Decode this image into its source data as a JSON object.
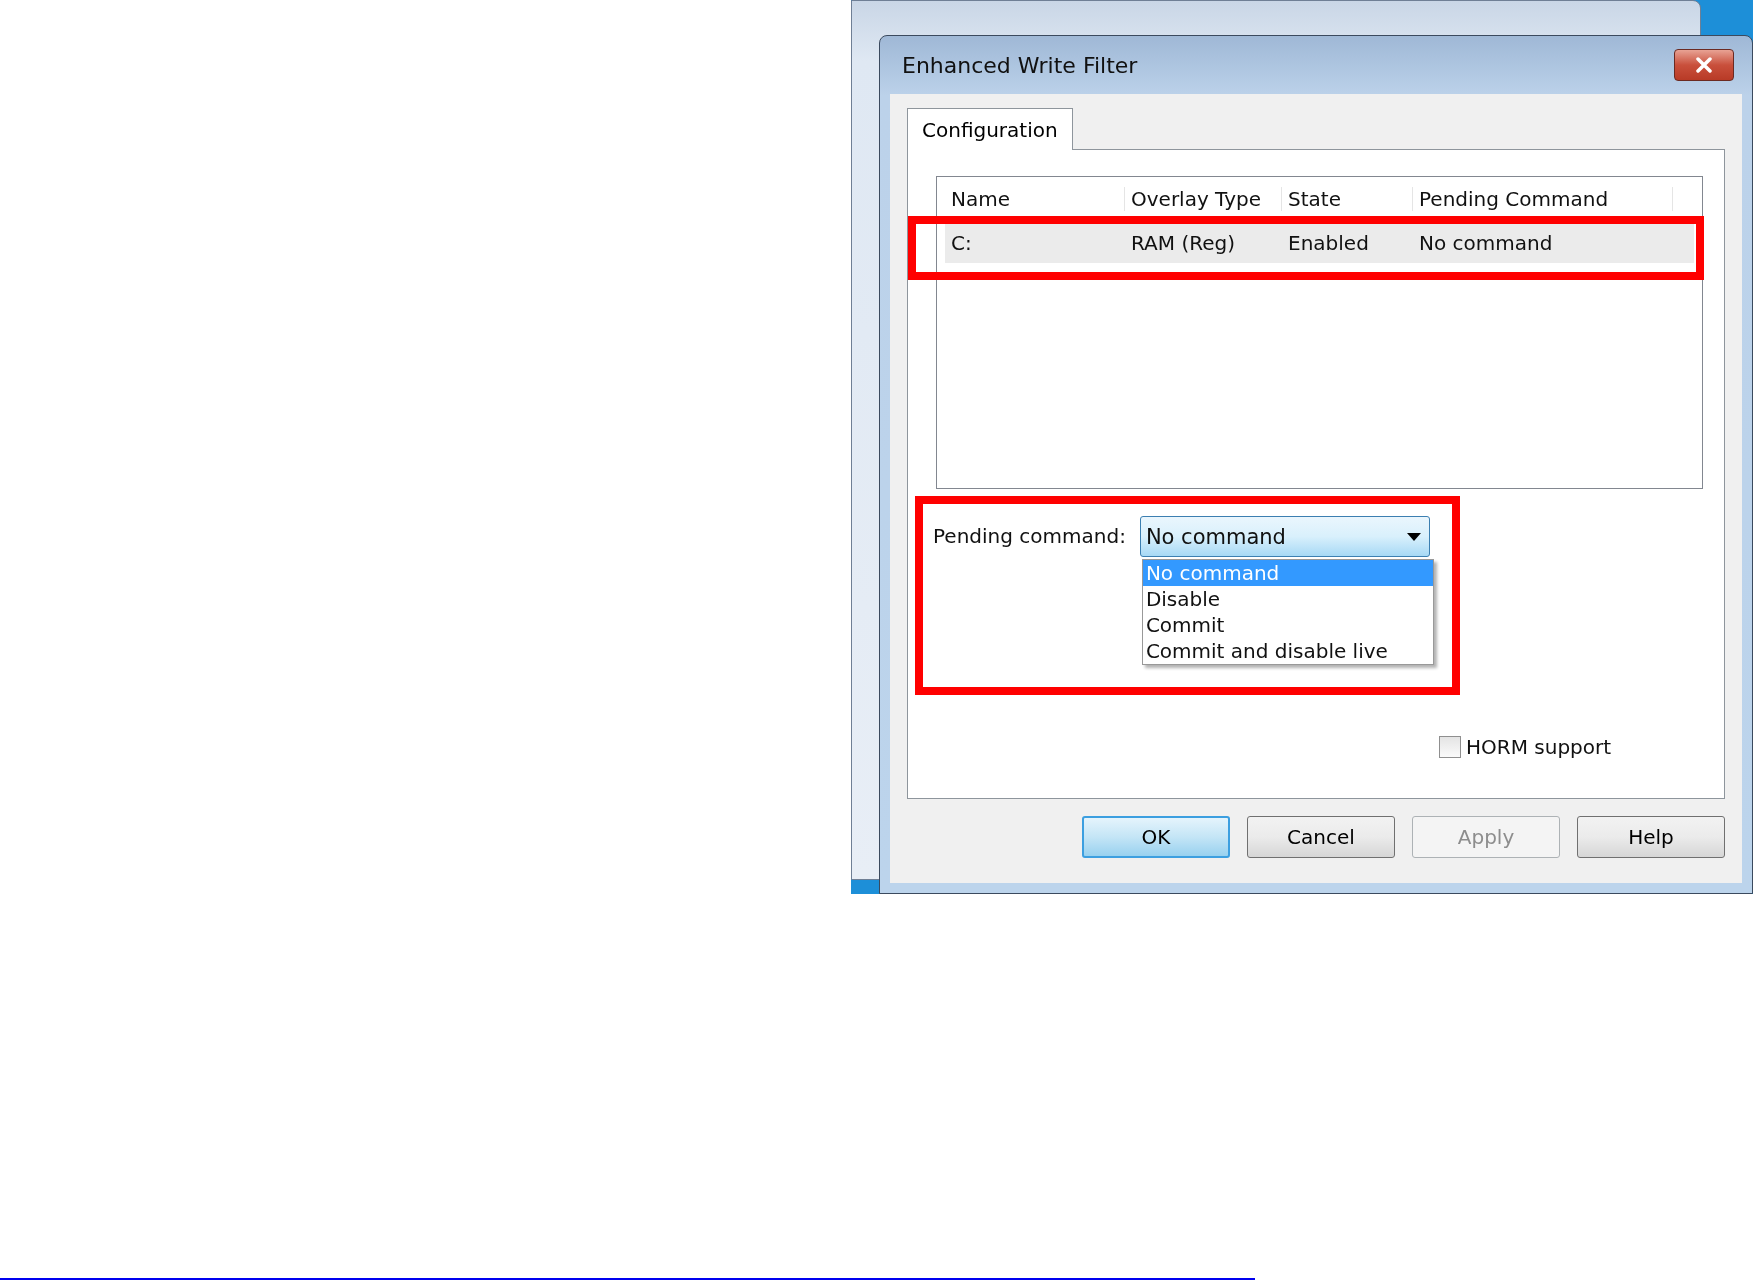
{
  "dialog": {
    "title": "Enhanced Write Filter"
  },
  "tabs": [
    {
      "label": "Configuration",
      "selected": true
    }
  ],
  "table": {
    "columns": [
      "Name",
      "Overlay Type",
      "State",
      "Pending Command"
    ],
    "rows": [
      {
        "cells": [
          "C:",
          "RAM (Reg)",
          "Enabled",
          "No command"
        ],
        "selected": true
      }
    ]
  },
  "pending_command": {
    "label": "Pending command:",
    "value": "No command",
    "expanded": true,
    "options": [
      {
        "label": "No command",
        "selected": true
      },
      {
        "label": "Disable",
        "selected": false
      },
      {
        "label": "Commit",
        "selected": false
      },
      {
        "label": "Commit and disable live",
        "selected": false
      }
    ]
  },
  "horm_support": {
    "label": "HORM support",
    "checked": false
  },
  "buttons": [
    {
      "label": "OK",
      "default": true,
      "disabled": false
    },
    {
      "label": "Cancel",
      "default": false,
      "disabled": false
    },
    {
      "label": "Apply",
      "default": false,
      "disabled": true
    },
    {
      "label": "Help",
      "default": false,
      "disabled": false
    }
  ]
}
